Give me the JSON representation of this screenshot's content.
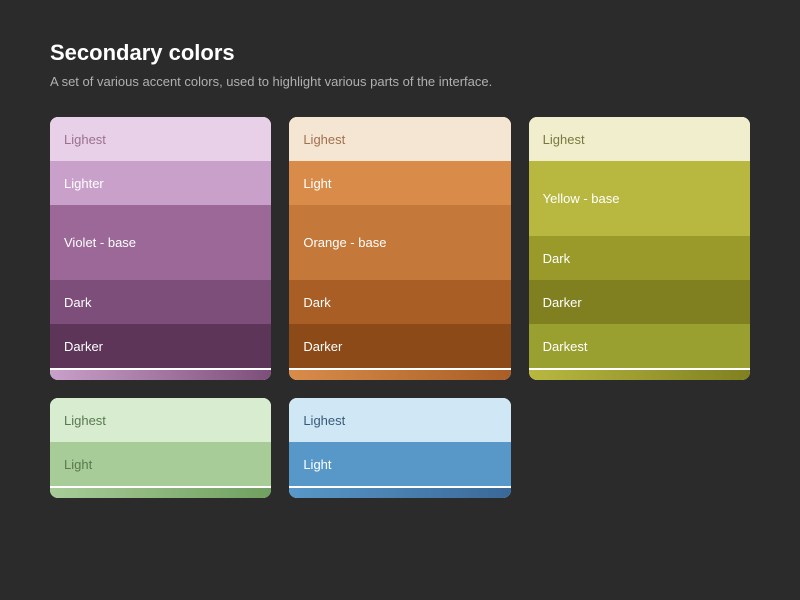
{
  "page": {
    "title": "Secondary colors",
    "subtitle": "A set of various accent colors, used to highlight various parts of the interface."
  },
  "palettes": [
    {
      "id": "violet",
      "swatches": [
        {
          "label": "Lighest",
          "bg": "#e8d0e8",
          "textColor": "#9a7090"
        },
        {
          "label": "Lighter",
          "bg": "#c9a0c9",
          "textColor": "#ffffff"
        },
        {
          "label": "Violet - base",
          "bg": "#9b6898",
          "textColor": "#ffffff",
          "tall": true
        },
        {
          "label": "Dark",
          "bg": "#7d4e7a",
          "textColor": "#ffffff"
        },
        {
          "label": "Darker",
          "bg": "#5c3559",
          "textColor": "#ffffff"
        }
      ],
      "barColor": "linear-gradient(to right, #c9a0c9, #7d4e7a)"
    },
    {
      "id": "orange",
      "swatches": [
        {
          "label": "Lighest",
          "bg": "#f5e6d3",
          "textColor": "#a07050"
        },
        {
          "label": "Light",
          "bg": "#d98c4a",
          "textColor": "#ffffff"
        },
        {
          "label": "Orange - base",
          "bg": "#c4783a",
          "textColor": "#ffffff",
          "tall": true
        },
        {
          "label": "Dark",
          "bg": "#a85e25",
          "textColor": "#ffffff"
        },
        {
          "label": "Darker",
          "bg": "#8c4a18",
          "textColor": "#ffffff"
        }
      ],
      "barColor": "linear-gradient(to right, #d98c4a, #a85e25)"
    },
    {
      "id": "yellow",
      "swatches": [
        {
          "label": "Lighest",
          "bg": "#f0eecc",
          "textColor": "#7a7840"
        },
        {
          "label": "Yellow - base",
          "bg": "#b8b840",
          "textColor": "#ffffff",
          "tall": true
        },
        {
          "label": "Dark",
          "bg": "#9a9a2a",
          "textColor": "#ffffff"
        },
        {
          "label": "Darker",
          "bg": "#808020",
          "textColor": "#ffffff"
        },
        {
          "label": "Darkest",
          "bg": "#9aa030",
          "textColor": "#ffffff"
        }
      ],
      "barColor": "linear-gradient(to right, #b8b840, #808020)"
    },
    {
      "id": "green",
      "swatches": [
        {
          "label": "Lighest",
          "bg": "#d8ecd0",
          "textColor": "#5a7850"
        },
        {
          "label": "Light",
          "bg": "#a8cc98",
          "textColor": "#5a7850"
        }
      ],
      "barColor": "linear-gradient(to right, #a8cc98, #70a060)"
    },
    {
      "id": "blue",
      "swatches": [
        {
          "label": "Lighest",
          "bg": "#d0e8f5",
          "textColor": "#3a5878"
        },
        {
          "label": "Light",
          "bg": "#5898c8",
          "textColor": "#ffffff"
        }
      ],
      "barColor": "linear-gradient(to right, #5898c8, #3a6898)"
    }
  ]
}
